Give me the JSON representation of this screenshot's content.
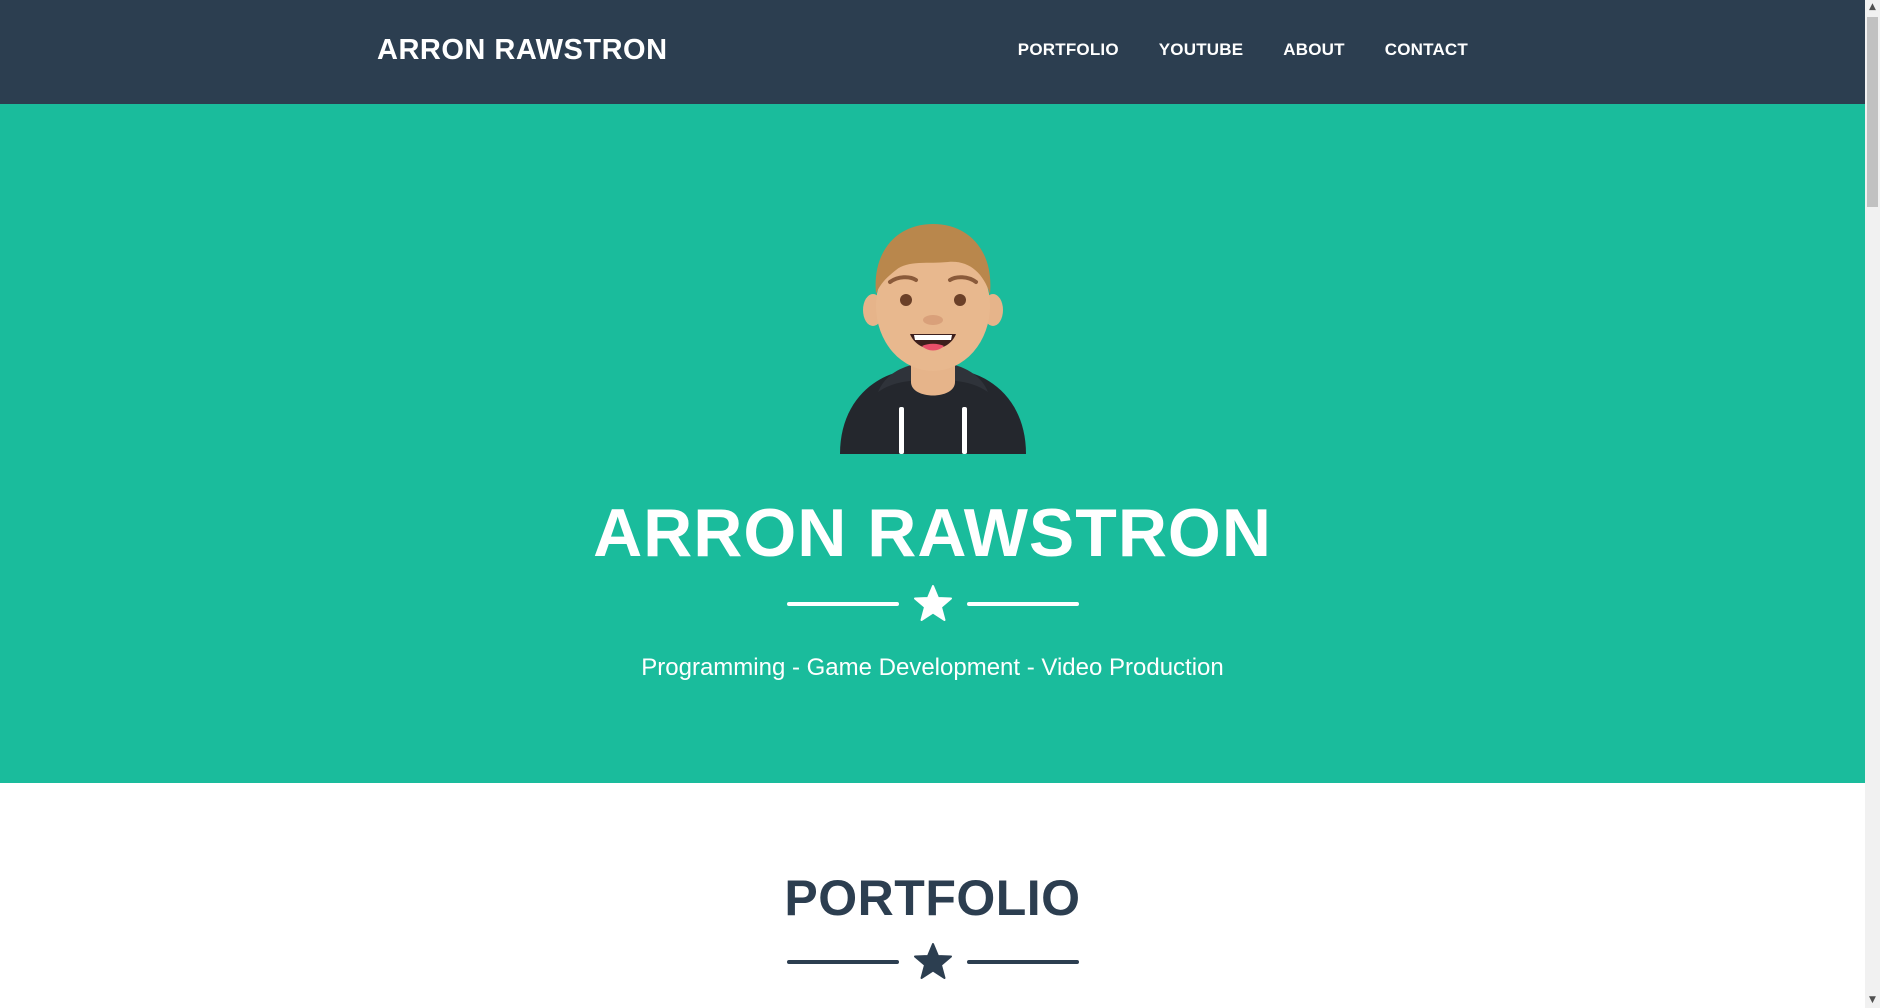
{
  "navbar": {
    "brand": "ARRON RAWSTRON",
    "links": [
      "PORTFOLIO",
      "YOUTUBE",
      "ABOUT",
      "CONTACT"
    ]
  },
  "hero": {
    "avatar_icon": "cartoon-avatar",
    "title": "ARRON RAWSTRON",
    "divider_icon": "star-icon",
    "subtitle": "Programming - Game Development - Video Production"
  },
  "portfolio": {
    "title": "PORTFOLIO",
    "divider_icon": "star-icon"
  },
  "colors": {
    "navbar": "#2c3e50",
    "hero": "#1abc9c",
    "text_light": "#ffffff",
    "text_dark": "#2c3e50"
  }
}
